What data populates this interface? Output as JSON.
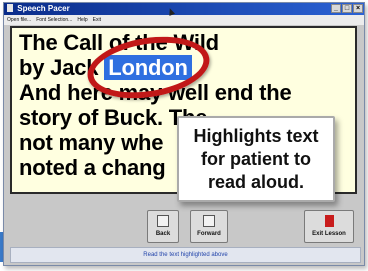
{
  "window": {
    "title": "Speech Pacer"
  },
  "menu": [
    "Open file...",
    "Font Selection...",
    "Help",
    "Exit"
  ],
  "window_controls": [
    "minimize-icon",
    "maximize-icon",
    "close-icon"
  ],
  "document": {
    "line1": "The Call of the Wild",
    "line2_prefix": "by Jack ",
    "line2_highlight": "London",
    "line3": "And here may well end the",
    "line4": "story of Buck. The",
    "line5": "not many whe",
    "line6": "noted a chang"
  },
  "callout": {
    "line1": "Highlights text",
    "line2": "for patient to",
    "line3": "read aloud."
  },
  "buttons": {
    "back": "Back",
    "forward": "Forward",
    "exit": "Exit Lesson"
  },
  "instruction": "Read the text highlighted above",
  "colors": {
    "highlight": "#2f6fe0",
    "document_bg": "#ffffe0",
    "callout_circle": "#c11818",
    "titlebar": "#0a2c8a"
  }
}
